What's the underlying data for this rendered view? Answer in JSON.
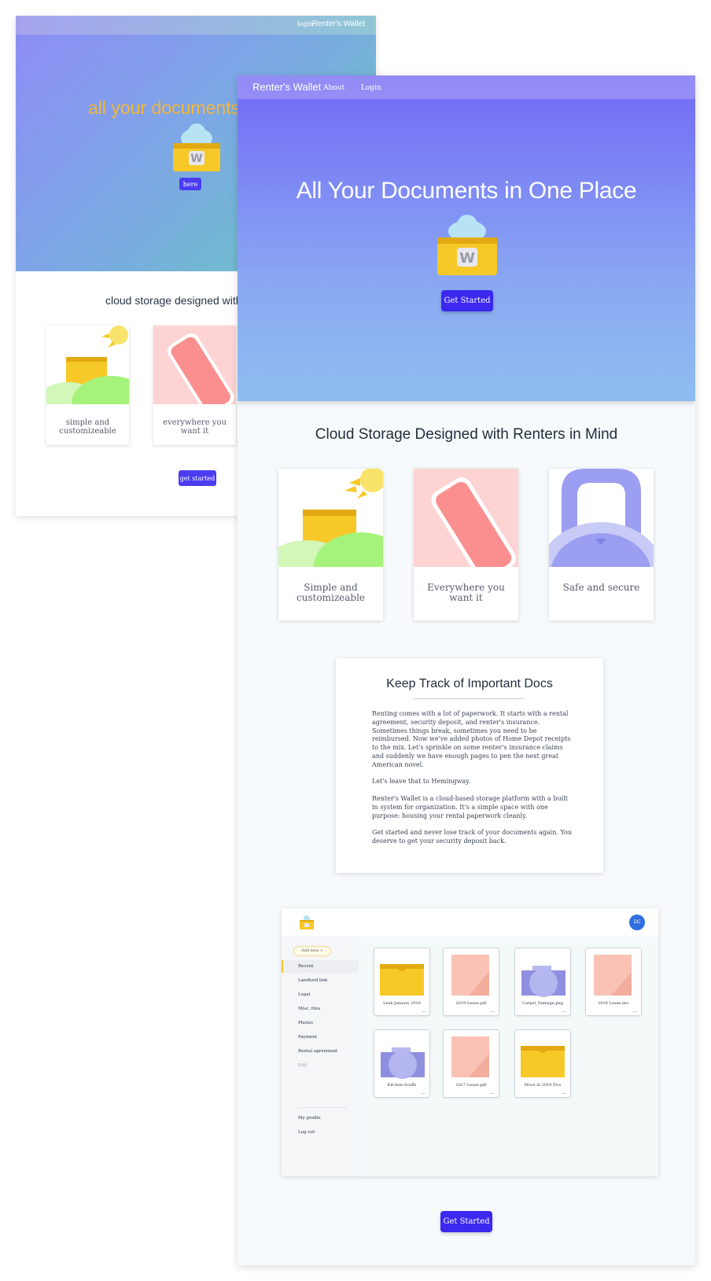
{
  "back_page": {
    "nav": {
      "login": "login",
      "brand": "Renter's Wallet"
    },
    "headline": "all your documents in",
    "hero_button": "here",
    "subtitle": "cloud storage designed with ren",
    "cards": [
      {
        "label": "simple and customizeable"
      },
      {
        "label": "everywhere you want it"
      }
    ],
    "cta_button": "get started"
  },
  "front_page": {
    "nav": {
      "brand": "Renter's Wallet",
      "about": "About",
      "login": "Login"
    },
    "hero": {
      "title": "All Your Documents in One Place",
      "button": "Get Started"
    },
    "section_title": "Cloud Storage Designed with Renters in Mind",
    "features": [
      {
        "label": "Simple and customizeable",
        "icon": "folder-sun-hills-icon"
      },
      {
        "label": "Everywhere you want it",
        "icon": "phone-icon"
      },
      {
        "label": "Safe and secure",
        "icon": "padlock-icon"
      }
    ],
    "docs_card": {
      "title": "Keep Track of Important Docs",
      "paragraphs": [
        "Renting comes with a lot of paperwork. It starts with a rental agreement, security deposit, and renter's insurance. Sometimes things break, sometimes you need to be reimbursed. Now we've added photos of Home Depot receipts to the mix. Let's sprinkle on some renter's insurance claims and suddenly we have enough pages to pen the next great American novel.",
        "Let's leave that to Hemingway.",
        "Renter's Wallet is a cloud-based storage platform with a built in system for organization. It's a simple space with one purpose: housing your rental paperwork cleanly.",
        "Get started and never lose track of your documents again. You deserve to get your security deposit back."
      ]
    },
    "app_preview": {
      "avatar": "DC",
      "add_new": "Add new +",
      "sidebar": [
        "Recent",
        "Landlord link",
        "Legal",
        "Misc. files",
        "Photos",
        "Payment",
        "Rental agreement",
        "Edit",
        "My profile",
        "Log out"
      ],
      "files": [
        {
          "name": "Leak January 2018",
          "kind": "folder"
        },
        {
          "name": "2019 Lease.pdf",
          "kind": "document"
        },
        {
          "name": "Carpet_Damage.png",
          "kind": "image"
        },
        {
          "name": "2018 Lease.doc",
          "kind": "document"
        },
        {
          "name": "Kitchen Scuffs",
          "kind": "image"
        },
        {
          "name": "2017 Lease.pdf",
          "kind": "document"
        },
        {
          "name": "Move in 2019 Pics",
          "kind": "folder"
        }
      ],
      "more": "..."
    },
    "cta_button": "Get Started"
  },
  "colors": {
    "primary_button": "#3c28ef",
    "hero_top": "#7169f6",
    "hero_bottom": "#8fbdf0",
    "folder_yellow": "#f7c928",
    "accent_orange": "#f3b73a"
  }
}
